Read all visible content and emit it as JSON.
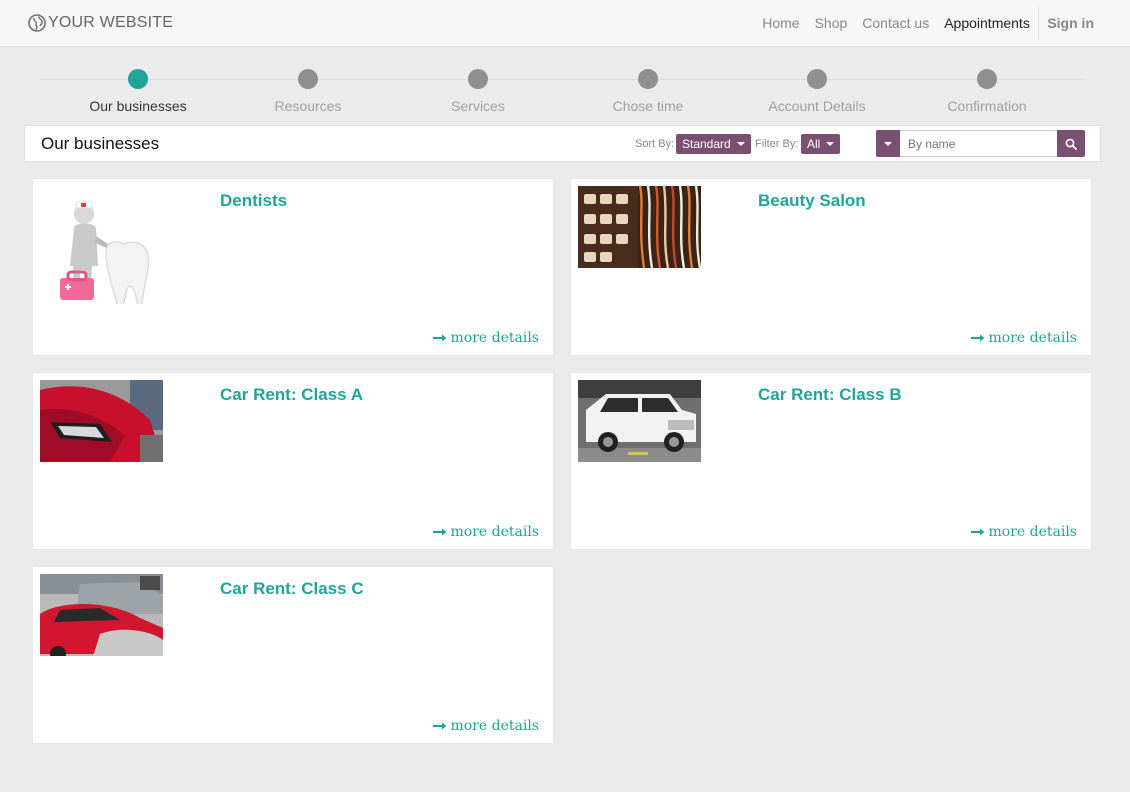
{
  "header": {
    "logo_text": "YOUR WEBSITE",
    "nav": [
      {
        "label": "Home"
      },
      {
        "label": "Shop"
      },
      {
        "label": "Contact us"
      },
      {
        "label": "Appointments",
        "active": true
      },
      {
        "label": "Sign in"
      }
    ]
  },
  "progress": {
    "steps": [
      {
        "label": "Our businesses",
        "active": true
      },
      {
        "label": "Resources"
      },
      {
        "label": "Services"
      },
      {
        "label": "Chose time"
      },
      {
        "label": "Account Details"
      },
      {
        "label": "Confirmation"
      }
    ]
  },
  "toolbar": {
    "title": "Our businesses",
    "sort_label": "Sort By:",
    "sort_value": "Standard",
    "filter_label": "Filter By:",
    "filter_value": "All",
    "search_placeholder": "By name"
  },
  "businesses": [
    {
      "name": "Dentists",
      "more": "more details",
      "image": "dentist-figure"
    },
    {
      "name": "Beauty Salon",
      "more": "more details",
      "image": "salon-shelf"
    },
    {
      "name": "Car Rent: Class A",
      "more": "more details",
      "image": "red-car-headlight"
    },
    {
      "name": "Car Rent: Class B",
      "more": "more details",
      "image": "white-suv"
    },
    {
      "name": "Car Rent: Class C",
      "more": "more details",
      "image": "parked-cars"
    }
  ],
  "colors": {
    "accent": "#21a59a",
    "brand": "#7b4f71",
    "step_inactive": "#8f8f8f"
  }
}
